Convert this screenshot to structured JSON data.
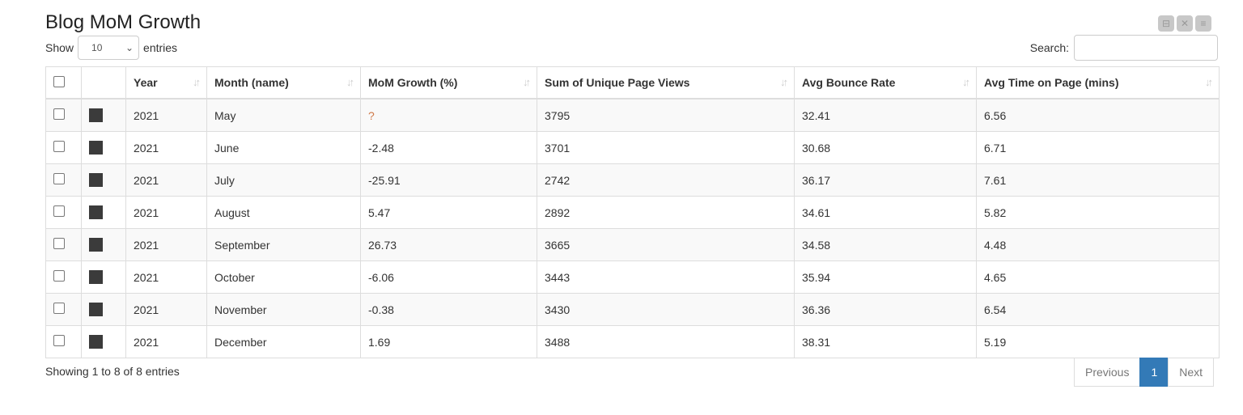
{
  "title": "Blog MoM Growth",
  "toolbar": {
    "icons": [
      "minimize-icon",
      "expand-icon",
      "menu-icon"
    ]
  },
  "length": {
    "show_label": "Show",
    "value": "10",
    "entries_label": "entries"
  },
  "search": {
    "label": "Search:",
    "value": "",
    "placeholder": ""
  },
  "table": {
    "columns": [
      "Year",
      "Month (name)",
      "MoM Growth (%)",
      "Sum of Unique Page Views",
      "Avg Bounce Rate",
      "Avg Time on Page (mins)"
    ],
    "swatch_color": "#3b3b3b",
    "rows": [
      [
        "2021",
        "May",
        "?",
        "3795",
        "32.41",
        "6.56"
      ],
      [
        "2021",
        "June",
        "-2.48",
        "3701",
        "30.68",
        "6.71"
      ],
      [
        "2021",
        "July",
        "-25.91",
        "2742",
        "36.17",
        "7.61"
      ],
      [
        "2021",
        "August",
        "5.47",
        "2892",
        "34.61",
        "5.82"
      ],
      [
        "2021",
        "September",
        "26.73",
        "3665",
        "34.58",
        "4.48"
      ],
      [
        "2021",
        "October",
        "-6.06",
        "3443",
        "35.94",
        "4.65"
      ],
      [
        "2021",
        "November",
        "-0.38",
        "3430",
        "36.36",
        "6.54"
      ],
      [
        "2021",
        "December",
        "1.69",
        "3488",
        "38.31",
        "5.19"
      ]
    ]
  },
  "footer": {
    "info": "Showing 1 to 8 of 8 entries",
    "previous": "Previous",
    "page": "1",
    "next": "Next"
  }
}
